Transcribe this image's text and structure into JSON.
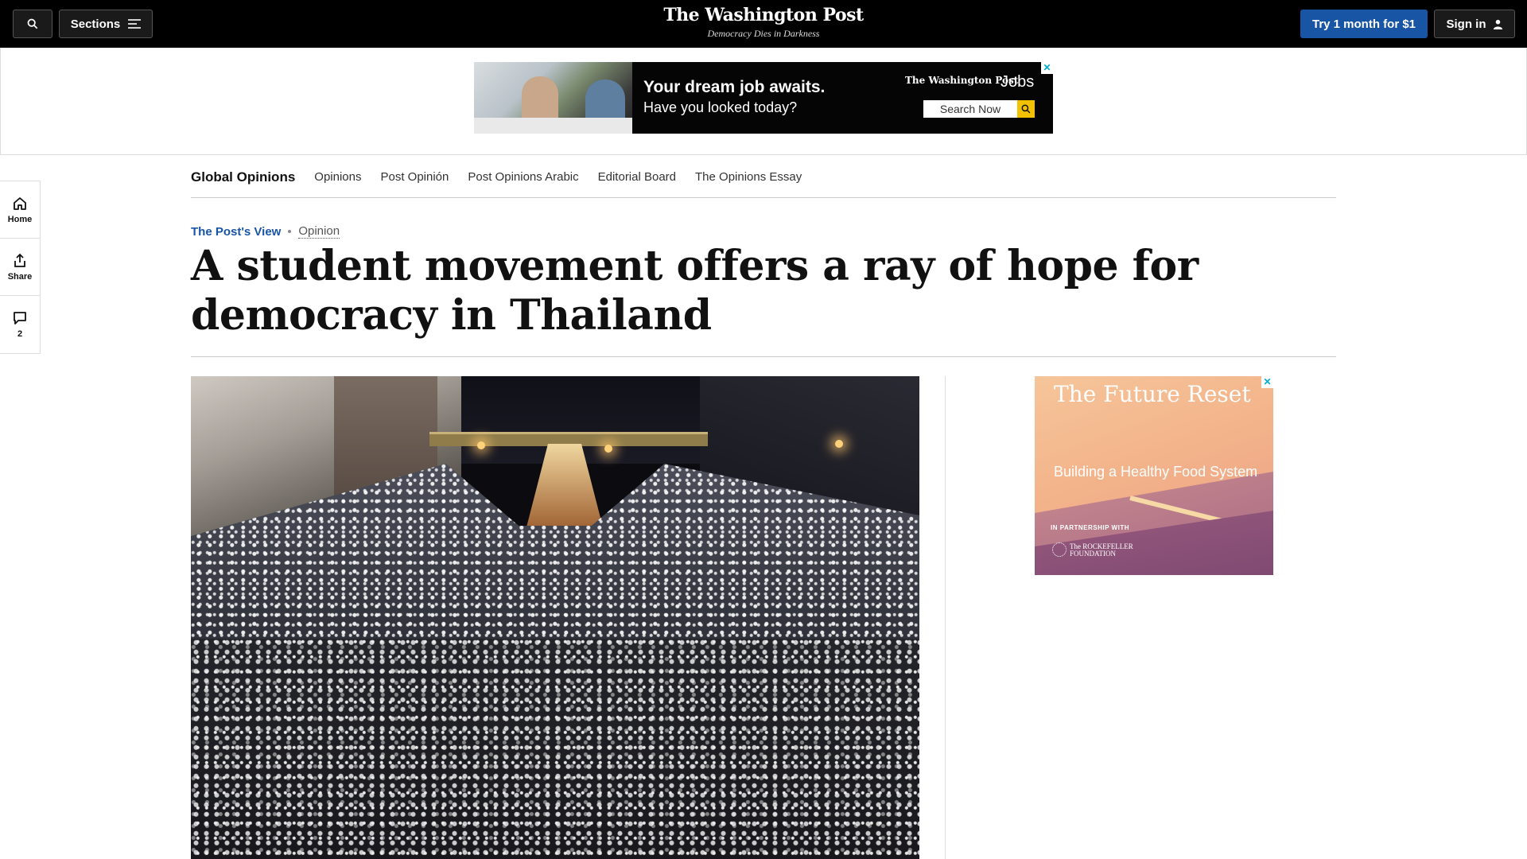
{
  "header": {
    "sections_label": "Sections",
    "logo_name": "The Washington Post",
    "logo_tagline": "Democracy Dies in Darkness",
    "subscribe_label": "Try 1 month for $1",
    "signin_label": "Sign in"
  },
  "top_ad": {
    "headline": "Your dream job awaits.",
    "subline": "Have you looked today?",
    "brand": "The Washington Post",
    "brand_suffix": "Jobs",
    "search_label": "Search Now",
    "close": "✕"
  },
  "section_nav": {
    "primary": "Global Opinions",
    "items": [
      "Opinions",
      "Post Opinión",
      "Post Opinions Arabic",
      "Editorial Board",
      "The Opinions Essay"
    ]
  },
  "left_rail": {
    "home_label": "Home",
    "share_label": "Share",
    "comments_count": "2"
  },
  "article": {
    "kicker": "The Post's View",
    "category": "Opinion",
    "headline": "A student movement offers a ray of hope for democracy in Thailand"
  },
  "side_ad": {
    "title": "The Future Reset",
    "subtitle": "Building a Healthy Food System",
    "partner_label": "IN PARTNERSHIP WITH",
    "partner_name": "The ROCKEFELLER FOUNDATION",
    "close": "✕"
  },
  "colors": {
    "accent_blue": "#1955a5",
    "header_bg": "#000000",
    "ad_close": "#00aecd",
    "ad_search_yellow": "#f2c200"
  }
}
